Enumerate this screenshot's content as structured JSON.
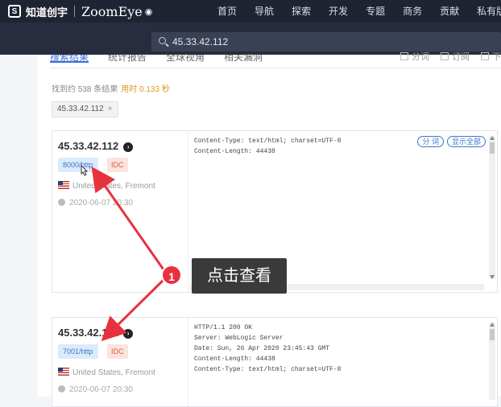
{
  "header": {
    "logo_cn": "知道创宇",
    "logo_en": "ZoomEye",
    "nav": [
      "首页",
      "导航",
      "探索",
      "开发",
      "专题",
      "商务",
      "贡献",
      "私有版"
    ]
  },
  "search": {
    "query": "45.33.42.112"
  },
  "tabs": [
    "搜索结果",
    "统计报告",
    "全球视角",
    "相关漏洞"
  ],
  "tools": [
    "分词",
    "订阅",
    "下载"
  ],
  "stats": {
    "found": "找到约 538 条结果",
    "time": "用时 0.133 秒"
  },
  "filter_chip": {
    "label": "45.33.42.112",
    "close": "×"
  },
  "results": [
    {
      "ip": "45.33.42.112",
      "port": "8000/http",
      "tag": "IDC",
      "country": "United States, Fremont",
      "date": "2020-06-07 20:30",
      "banner": "Content-Type: text/html; charset=UTF-8\nContent-Length: 44438",
      "buttons": [
        "分 词",
        "显示全部"
      ]
    },
    {
      "ip": "45.33.42.112",
      "port": "7001/http",
      "tag": "IDC",
      "country": "United States, Fremont",
      "date": "2020-06-07 20:30",
      "banner": "HTTP/1.1 200 OK\nServer: WebLogic Server\nDate: Sun, 26 Apr 2020 23:45:43 GMT\nContent-Length: 44438\nContent-Type: text/html; charset=UTF-8",
      "buttons": []
    }
  ],
  "annotation": {
    "number": "1",
    "text": "点击查看",
    "color": "#e8313f"
  }
}
